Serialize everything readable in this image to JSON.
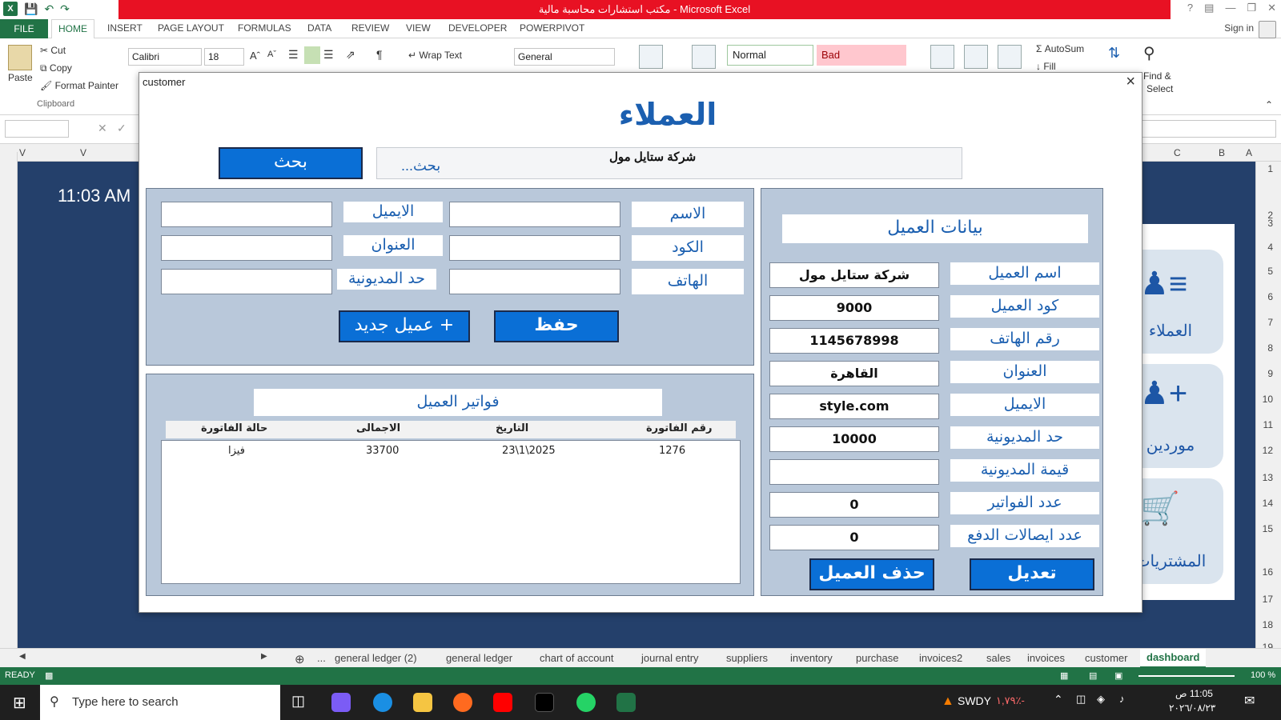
{
  "window": {
    "title": "مكتب استشارات محاسبة مالية  -  Microsoft Excel"
  },
  "ribbon_tabs": [
    "FILE",
    "HOME",
    "INSERT",
    "PAGE LAYOUT",
    "FORMULAS",
    "DATA",
    "REVIEW",
    "VIEW",
    "DEVELOPER",
    "POWERPIVOT"
  ],
  "signin": "Sign in",
  "ribbon": {
    "paste": "Paste",
    "cut": "Cut",
    "copy": "Copy",
    "format_painter": "Format Painter",
    "clipboard": "Clipboard",
    "font_name": "Calibri",
    "font_size": "18",
    "wrap_text": "Wrap Text",
    "number_format": "General",
    "style_normal": "Normal",
    "style_bad": "Bad",
    "autosum": "AutoSum",
    "fill": "Fill",
    "find_select_1": "Find &",
    "find_select_2": "Select"
  },
  "columns": {
    "v1": "V",
    "v2": "V",
    "c": "C",
    "b": "B",
    "a": "A"
  },
  "rows": [
    "1",
    "2",
    "3",
    "4",
    "5",
    "6",
    "7",
    "8",
    "9",
    "10",
    "11",
    "12",
    "13",
    "14",
    "15",
    "16",
    "17",
    "18",
    "19"
  ],
  "sheet": {
    "time_cell": "11:03 AM",
    "dash_customers": "العملاء",
    "dash_suppliers": "موردين",
    "dash_purchases": "المشتريات"
  },
  "dialog": {
    "title": "customer",
    "heading": "العملاء",
    "search_button": "بحث",
    "search_value": "شركة ستايل مول",
    "search_placeholder": "بحث...",
    "form": {
      "name_label": "الاسم",
      "code_label": "الكود",
      "phone_label": "الهاتف",
      "email_label": "الايميل",
      "address_label": "العنوان",
      "debt_limit_label": "حد المديونية",
      "save_button": "حفظ",
      "new_button": "+ عميل جديد"
    },
    "invoices": {
      "title": "فواتير العميل",
      "headers": [
        "رقم الفاتورة",
        "التاريخ",
        "الاجمالى",
        "حالة الفاتورة"
      ],
      "rows": [
        {
          "number": "1276",
          "date": "23\\1\\2025",
          "total": "33700",
          "status": "فيزا"
        }
      ]
    },
    "details": {
      "title": "بيانات العميل",
      "fields": [
        {
          "label": "اسم العميل",
          "value": "شركة ستايل مول"
        },
        {
          "label": "كود العميل",
          "value": "9000"
        },
        {
          "label": "رقم الهاتف",
          "value": "1145678998"
        },
        {
          "label": "العنوان",
          "value": "القاهرة"
        },
        {
          "label": "الايميل",
          "value": "style.com"
        },
        {
          "label": "حد المديونية",
          "value": "10000"
        },
        {
          "label": "قيمة المديونية",
          "value": ""
        },
        {
          "label": "عدد الفواتير",
          "value": "0"
        },
        {
          "label": "عدد ايصالات الدفع",
          "value": "0"
        }
      ],
      "edit_button": "تعديل",
      "delete_button": "حذف العميل"
    }
  },
  "sheet_tabs": [
    "...",
    "general ledger (2)",
    "general ledger",
    "chart of account",
    "journal entry",
    "suppliers",
    "inventory",
    "purchase",
    "invoices2",
    "sales",
    "invoices",
    "customer",
    "dashboard"
  ],
  "status": {
    "ready": "READY",
    "zoom": "100 %"
  },
  "taskbar": {
    "search_placeholder": "Type here to search",
    "ticker": "SWDY",
    "ticker_change": "-٪١,٧٩",
    "clock_time": "11:05 ص",
    "clock_date": "٢٠٢٦/٠٨/٢٣"
  }
}
